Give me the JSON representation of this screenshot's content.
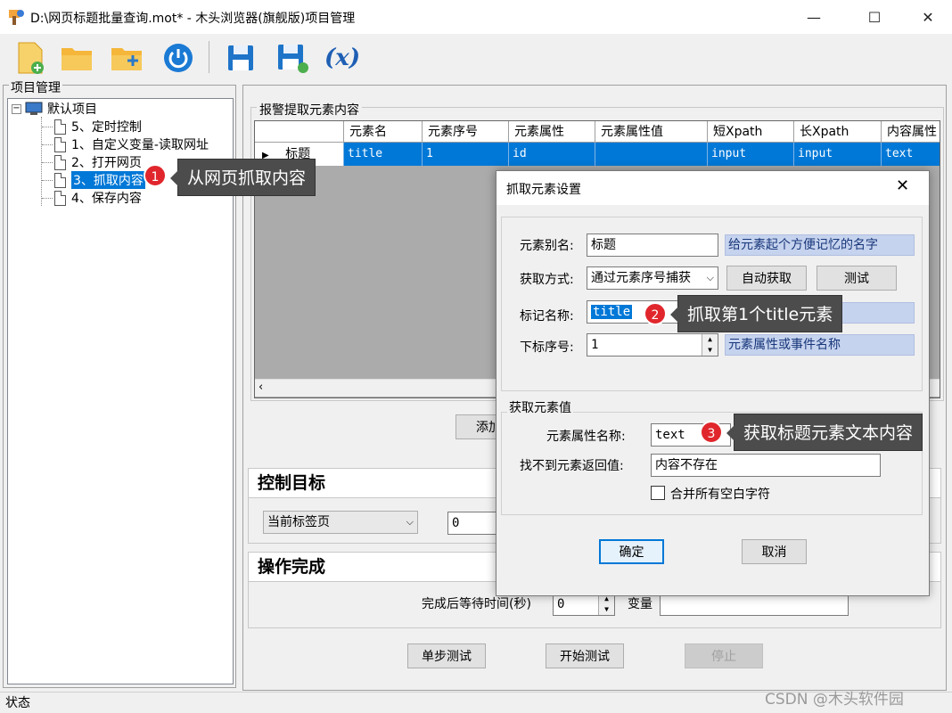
{
  "window": {
    "title": "D:\\网页标题批量查询.mot* - 木头浏览器(旗舰版)项目管理",
    "minimize": "—",
    "maximize": "☐",
    "close": "✕"
  },
  "toolbar": {
    "items": [
      "new-file-icon",
      "open-folder-icon",
      "add-folder-icon",
      "power-icon",
      "save-icon",
      "save-as-icon",
      "variable-icon"
    ],
    "variable_label": "(x)"
  },
  "project_panel": {
    "title": "项目管理",
    "root": "默认项目",
    "items": [
      "5、定时控制",
      "1、自定义变量-读取网址",
      "2、打开网页",
      "3、抓取内容",
      "4、保存内容"
    ],
    "selected_index": 3
  },
  "alarm_section": {
    "title": "报警提取元素内容",
    "columns": [
      "元素名",
      "元素序号",
      "元素属性",
      "元素属性值",
      "短Xpath",
      "长Xpath",
      "内容属性"
    ],
    "rows": [
      {
        "name": "标题",
        "cells": [
          "title",
          "1",
          "id",
          "",
          "input",
          "input",
          "text"
        ]
      }
    ],
    "add_button": "添加"
  },
  "control_section": {
    "title": "控制目标",
    "tab_select": "当前标签页",
    "number_value": "0"
  },
  "finish_section": {
    "title": "操作完成",
    "wait_label": "完成后等待时间(秒)",
    "wait_value": "0",
    "variable_label": "变量",
    "variable_value": ""
  },
  "bottom_buttons": {
    "step_test": "单步测试",
    "start_test": "开始测试",
    "stop": "停止"
  },
  "dialog": {
    "title": "抓取元素设置",
    "alias_label": "元素别名:",
    "alias_value": "标题",
    "alias_hint": "给元素起个方便记忆的名字",
    "method_label": "获取方式:",
    "method_value": "通过元素序号捕获",
    "auto_button": "自动获取",
    "test_button": "测试",
    "tag_label": "标记名称:",
    "tag_value": "title",
    "index_label": "下标序号:",
    "index_value": "1",
    "index_hint": "元素属性或事件名称",
    "value_group": "获取元素值",
    "attr_label": "元素属性名称:",
    "attr_value": "text",
    "notfound_label": "找不到元素返回值:",
    "notfound_value": "内容不存在",
    "merge_label": "合并所有空白字符",
    "ok_button": "确定",
    "cancel_button": "取消"
  },
  "callouts": [
    {
      "number": "1",
      "text": "从网页抓取内容"
    },
    {
      "number": "2",
      "text": "抓取第1个title元素"
    },
    {
      "number": "3",
      "text": "获取标题元素文本内容"
    }
  ],
  "status_text": "状态",
  "watermark": "CSDN @木头软件园"
}
